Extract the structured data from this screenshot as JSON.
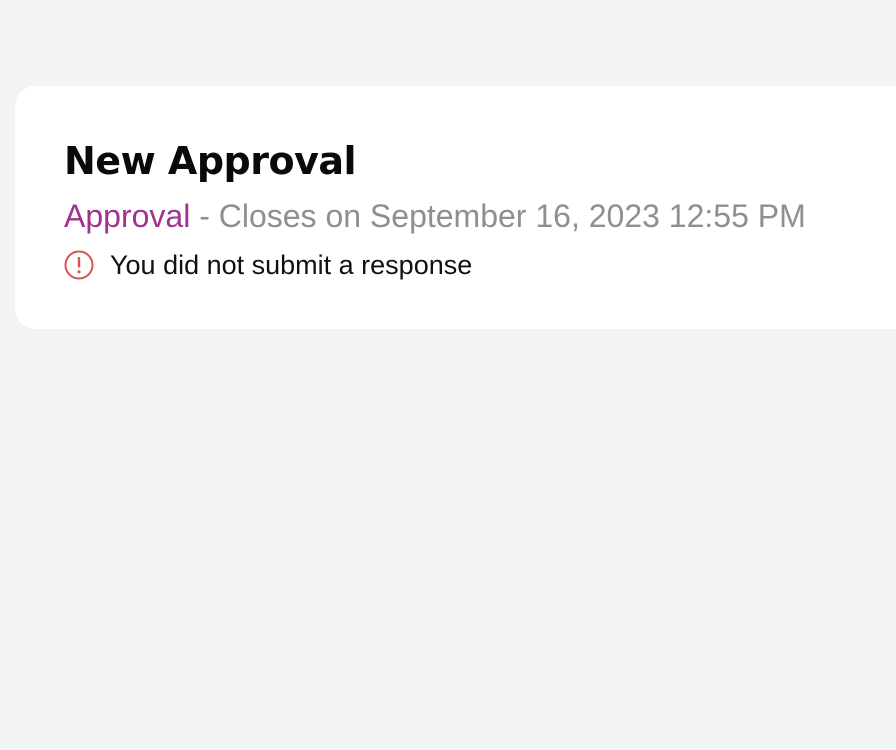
{
  "card": {
    "title": "New Approval",
    "type_label": "Approval",
    "separator": "-",
    "closes_text": "Closes on September 16, 2023 12:55 PM",
    "status_icon": "alert-circle-icon",
    "status_text": "You did not submit a response"
  },
  "colors": {
    "background": "#f2f3f5",
    "card": "#ffffff",
    "accent": "#a1338f",
    "muted": "#8f8f93",
    "alert": "#d9534f"
  }
}
